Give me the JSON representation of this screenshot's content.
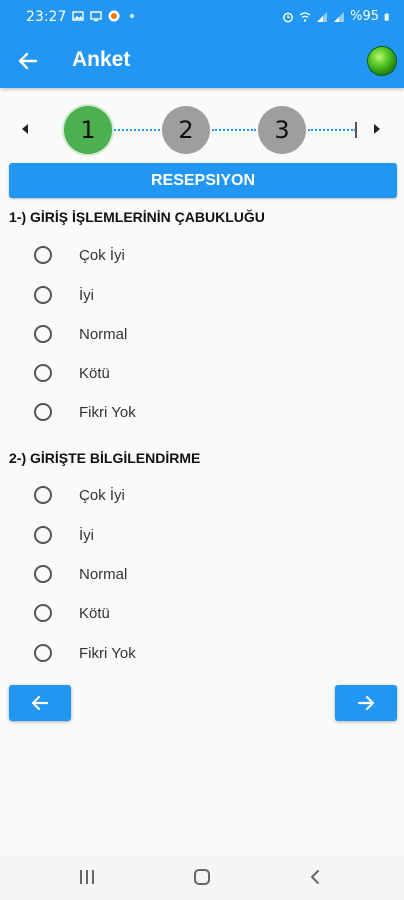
{
  "status_bar": {
    "time": "23:27",
    "battery_text": "%95"
  },
  "app_bar": {
    "title": "Anket"
  },
  "stepper": {
    "steps": [
      "1",
      "2",
      "3"
    ],
    "active_step": 1
  },
  "section": {
    "title": "RESEPSIYON"
  },
  "questions": [
    {
      "title": "1-) GİRİŞ İŞLEMLERİNİN ÇABUKLUĞU",
      "options": [
        "Çok İyi",
        "İyi",
        "Normal",
        "Kötü",
        "Fikri Yok"
      ]
    },
    {
      "title": "2-) GİRİŞTE BİLGİLENDİRME",
      "options": [
        "Çok İyi",
        "İyi",
        "Normal",
        "Kötü",
        "Fikri Yok"
      ]
    }
  ],
  "colors": {
    "primary": "#2196f3",
    "active_step": "#4caf50",
    "inactive_step": "#9e9e9e"
  },
  "icons": {
    "back": "arrow-left-icon",
    "globe": "globe-icon",
    "prev": "arrow-left-icon",
    "next": "arrow-right-icon"
  }
}
